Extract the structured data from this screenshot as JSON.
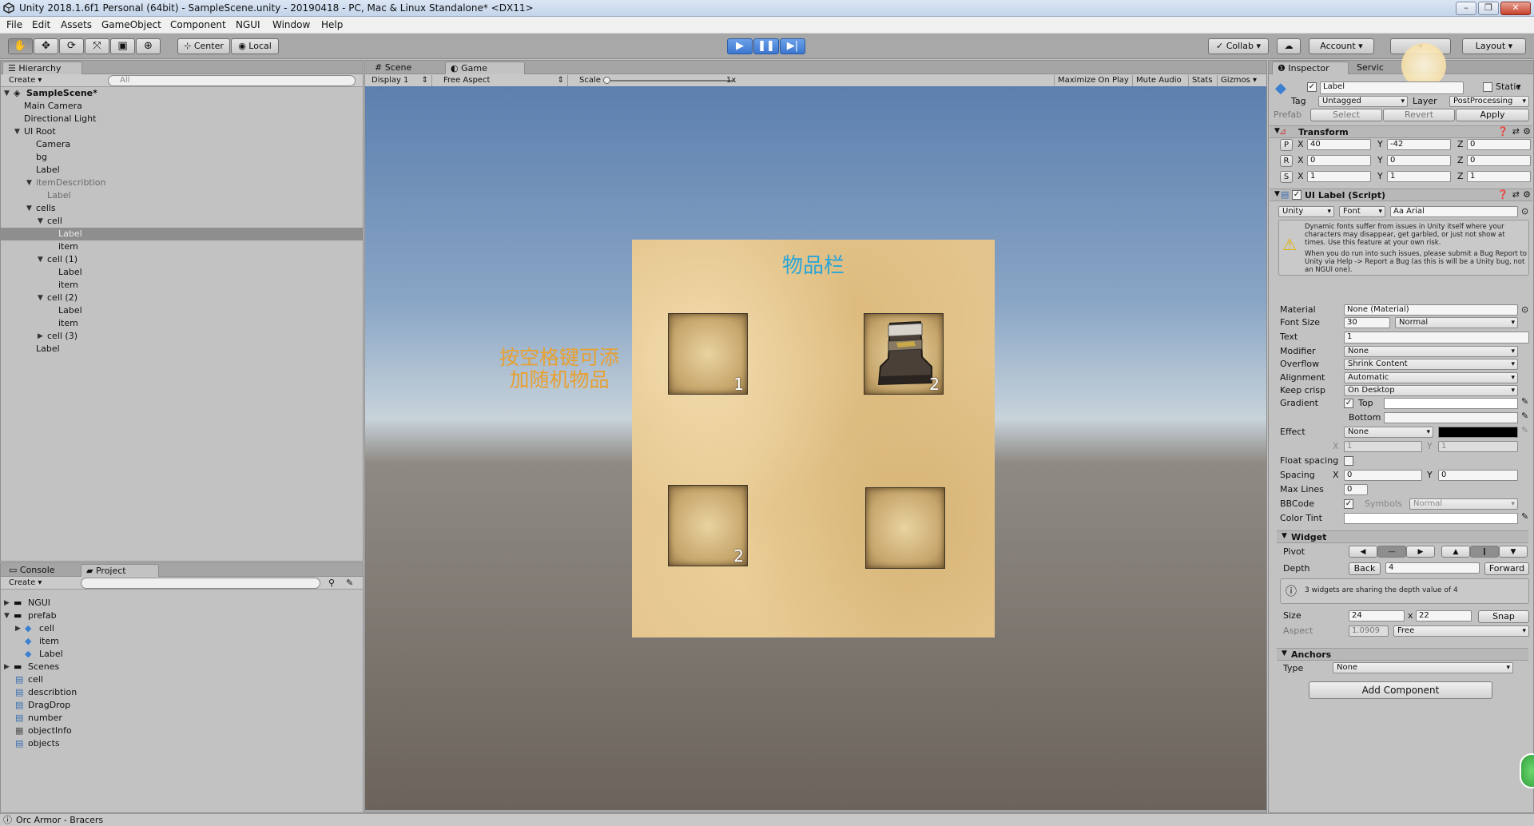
{
  "window": {
    "title": "Unity 2018.1.6f1 Personal (64bit) - SampleScene.unity - 20190418 - PC, Mac & Linux Standalone* <DX11>",
    "buttons": [
      "–",
      "❐",
      "✕"
    ]
  },
  "menu": [
    "File",
    "Edit",
    "Assets",
    "GameObject",
    "Component",
    "NGUI",
    "Window",
    "Help"
  ],
  "toolbar": {
    "center_label": "Center",
    "local_label": "Local",
    "collab_label": "Collab",
    "account_label": "Account",
    "layout_label": "Layout"
  },
  "hierarchy": {
    "tab_label": "Hierarchy",
    "create_label": "Create",
    "search_placeholder": "All",
    "scene_name": "SampleScene*",
    "items": [
      {
        "label": "Main Camera"
      },
      {
        "label": "Directional Light"
      },
      {
        "label": "UI Root"
      },
      {
        "label": "Camera"
      },
      {
        "label": "bg"
      },
      {
        "label": "Label"
      },
      {
        "label": "itemDescribtion"
      },
      {
        "label": "Label"
      },
      {
        "label": "cells"
      },
      {
        "label": "cell"
      },
      {
        "label": "Label"
      },
      {
        "label": "item"
      },
      {
        "label": "cell (1)"
      },
      {
        "label": "Label"
      },
      {
        "label": "item"
      },
      {
        "label": "cell (2)"
      },
      {
        "label": "Label"
      },
      {
        "label": "item"
      },
      {
        "label": "cell (3)"
      },
      {
        "label": "Label"
      }
    ]
  },
  "project": {
    "console_tab": "Console",
    "project_tab": "Project",
    "create_label": "Create",
    "items": [
      {
        "label": "NGUI"
      },
      {
        "label": "prefab"
      },
      {
        "label": "cell"
      },
      {
        "label": "item"
      },
      {
        "label": "Label"
      },
      {
        "label": "Scenes"
      },
      {
        "label": "cell"
      },
      {
        "label": "describtion"
      },
      {
        "label": "DragDrop"
      },
      {
        "label": "number"
      },
      {
        "label": "objectInfo"
      },
      {
        "label": "objects"
      }
    ]
  },
  "game": {
    "scene_tab": "Scene",
    "game_tab": "Game",
    "display": "Display 1",
    "aspect": "Free Aspect",
    "scale_label": "Scale",
    "scale_value": "1x",
    "maximize": "Maximize On Play",
    "mute": "Mute Audio",
    "stats": "Stats",
    "gizmos": "Gizmos",
    "panel_title": "物品栏",
    "hint_text_line1": "按空格键可添",
    "hint_text_line2": "加随机物品",
    "cells": [
      {
        "count": "1",
        "has_item": false
      },
      {
        "count": "2",
        "has_item": true
      },
      {
        "count": "2",
        "has_item": false
      },
      {
        "count": "",
        "has_item": false
      }
    ]
  },
  "inspector": {
    "tab_label": "Inspector",
    "services_tab": "Servic",
    "object_name": "Label",
    "static_label": "Static",
    "tag_label": "Tag",
    "tag_value": "Untagged",
    "layer_label": "Layer",
    "layer_value": "PostProcessing",
    "prefab_label": "Prefab",
    "select_label": "Select",
    "revert_label": "Revert",
    "apply_label": "Apply",
    "transform": {
      "title": "Transform",
      "pos": {
        "label": "P",
        "x": "40",
        "y": "-42",
        "z": "0"
      },
      "rot": {
        "label": "R",
        "x": "0",
        "y": "0",
        "z": "0"
      },
      "scale": {
        "label": "S",
        "x": "1",
        "y": "1",
        "z": "1"
      }
    },
    "uilabel": {
      "title": "UI Label (Script)",
      "font_type": "Unity",
      "font_kind": "Font",
      "font_name": "Arial",
      "warning1": "Dynamic fonts suffer from issues in Unity itself where your characters may disappear, get garbled, or just not show at times. Use this feature at your own risk.",
      "warning2": "When you do run into such issues, please submit a Bug Report to Unity via Help -> Report a Bug (as this is will be a Unity bug, not an NGUI one).",
      "material_label": "Material",
      "material_value": "None (Material)",
      "font_size_label": "Font Size",
      "font_size_value": "30",
      "font_style": "Normal",
      "text_label": "Text",
      "text_value": "1",
      "modifier_label": "Modifier",
      "modifier_value": "None",
      "overflow_label": "Overflow",
      "overflow_value": "Shrink Content",
      "alignment_label": "Alignment",
      "alignment_value": "Automatic",
      "keepcrisp_label": "Keep crisp",
      "keepcrisp_value": "On Desktop",
      "gradient_label": "Gradient",
      "top_label": "Top",
      "bottom_label": "Bottom",
      "effect_label": "Effect",
      "effect_value": "None",
      "effect_x_label": "X",
      "effect_x": "1",
      "effect_y_label": "Y",
      "effect_y": "1",
      "float_spacing_label": "Float spacing",
      "spacing_label": "Spacing",
      "spacing_x_label": "X",
      "spacing_x": "0",
      "spacing_y_label": "Y",
      "spacing_y": "0",
      "maxlines_label": "Max Lines",
      "maxlines_value": "0",
      "bbcode_label": "BBCode",
      "symbols_label": "Symbols",
      "symbols_value": "Normal",
      "colortint_label": "Color Tint"
    },
    "widget": {
      "title": "Widget",
      "pivot_label": "Pivot",
      "depth_label": "Depth",
      "back_label": "Back",
      "depth_value": "4",
      "forward_label": "Forward",
      "depth_info": "3 widgets are sharing the depth value of 4",
      "size_label": "Size",
      "size_w": "24",
      "size_x": "x",
      "size_h": "22",
      "snap_label": "Snap",
      "aspect_label": "Aspect",
      "aspect_value": "1.0909",
      "aspect_mode": "Free"
    },
    "anchors": {
      "title": "Anchors",
      "type_label": "Type",
      "type_value": "None"
    },
    "add_component": "Add Component"
  },
  "status": "Orc Armor - Bracers",
  "colors": {
    "title_color": "#2aa5d8",
    "hint_color": "#e8a030",
    "play_blue": "#3b76d0"
  }
}
